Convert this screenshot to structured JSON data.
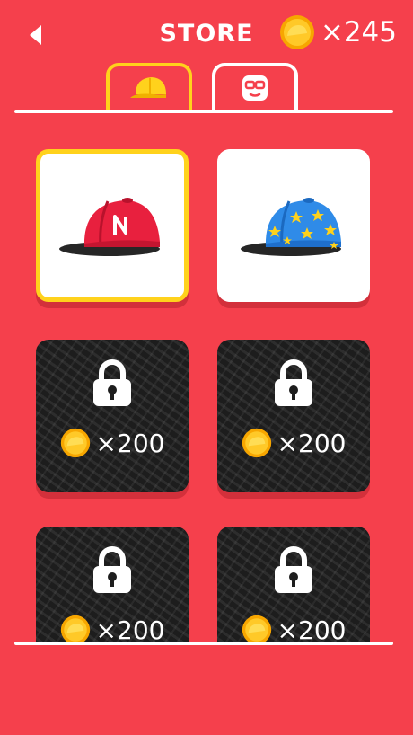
{
  "header": {
    "title": "STORE",
    "coin_count": "×245",
    "back_icon": "back-arrow-icon",
    "coin_icon": "coin-icon"
  },
  "tabs": [
    {
      "icon": "cap-icon",
      "active": true
    },
    {
      "icon": "glasses-face-icon",
      "active": false
    }
  ],
  "items": [
    {
      "name": "red-n-cap",
      "locked": false,
      "selected": true
    },
    {
      "name": "blue-star-cap",
      "locked": false,
      "selected": false
    },
    {
      "locked": true,
      "price": "×200"
    },
    {
      "locked": true,
      "price": "×200"
    },
    {
      "locked": true,
      "price": "×200"
    },
    {
      "locked": true,
      "price": "×200"
    }
  ],
  "colors": {
    "background": "#F5404C",
    "accent": "#FFD21C",
    "cap_red": "#E8203E",
    "cap_blue": "#2F8BE8",
    "star_yellow": "#FFD21C",
    "locked_card": "#1d1d1d"
  }
}
